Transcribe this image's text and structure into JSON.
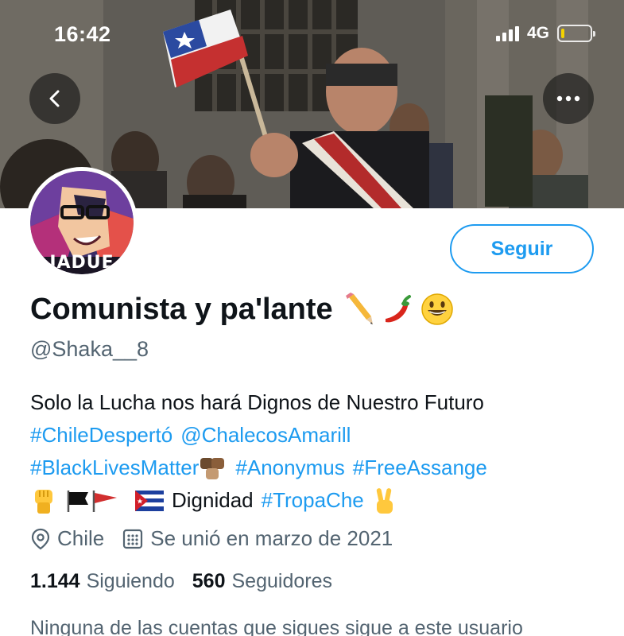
{
  "status_bar": {
    "time": "16:42",
    "network": "4G",
    "signal_bars": 4,
    "battery_level": 0.12,
    "battery_color": "#f5d300"
  },
  "header": {
    "back_icon": "chevron-left-icon",
    "more_icon": "ellipsis-icon"
  },
  "avatar": {
    "caption": "JADUE"
  },
  "follow_button": {
    "label": "Seguir"
  },
  "profile": {
    "display_name": "Comunista y pa'lante",
    "display_name_emojis": [
      "pencil",
      "hot-pepper",
      "grinning-face"
    ],
    "handle": "@Shaka__8"
  },
  "bio": {
    "line1": "Solo la Lucha nos hará Dignos de Nuestro Futuro",
    "hashtag_chile": "#ChileDespertó",
    "mention_chalecos": "@ChalecosAmarill",
    "hashtag_blm": "#BlackLivesMatter",
    "hashtag_anonymus": "#Anonymus",
    "hashtag_assange": "#FreeAssange",
    "word_dignidad": "Dignidad",
    "hashtag_tropache": "#TropaChe"
  },
  "meta": {
    "location": "Chile",
    "joined": "Se unió en marzo de 2021"
  },
  "stats": {
    "following_count": "1.144",
    "following_label": "Siguiendo",
    "followers_count": "560",
    "followers_label": "Seguidores"
  },
  "followers_note": "Ninguna de las cuentas que sigues sigue a este usuario",
  "colors": {
    "accent": "#1d9bf0",
    "text": "#0f1419",
    "secondary": "#536471"
  }
}
